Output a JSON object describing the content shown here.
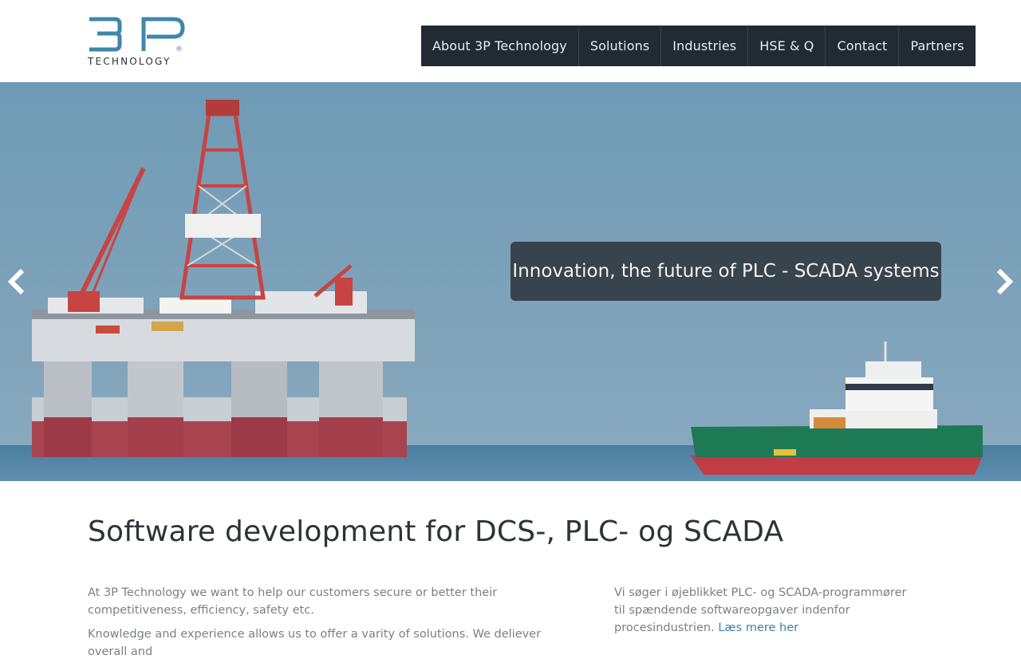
{
  "header": {
    "logo": {
      "main": "3P",
      "sub": "TECHNOLOGY",
      "mark": "®",
      "color": "#3f86ad"
    },
    "nav": [
      {
        "id": "about",
        "label": "About 3P Technology"
      },
      {
        "id": "solutions",
        "label": "Solutions"
      },
      {
        "id": "industries",
        "label": "Industries"
      },
      {
        "id": "hse",
        "label": "HSE & Q"
      },
      {
        "id": "contact",
        "label": "Contact"
      },
      {
        "id": "partners",
        "label": "Partners"
      }
    ]
  },
  "hero": {
    "caption": "Innovation, the future of PLC - SCADA systems",
    "prev_icon": "chevron-left-icon",
    "next_icon": "chevron-right-icon"
  },
  "main": {
    "title": "Software development for DCS-, PLC- og SCADA",
    "left": {
      "p1": "At 3P Technology we want to help our customers secure or better their competitiveness, efficiency, safety etc.",
      "p2": "Knowledge and experience allows us to offer a varity of solutions. We deliever overall and"
    },
    "right": {
      "text": "Vi søger i øjeblikket PLC- og SCADA-programmører til spændende softwareopgaver indenfor procesindustrien.",
      "link": "Læs mere her"
    }
  },
  "colors": {
    "nav_bg": "#222a33",
    "accent": "#3f86ad",
    "sea": "#4d7fa0",
    "sky": "#7ba0b8"
  }
}
